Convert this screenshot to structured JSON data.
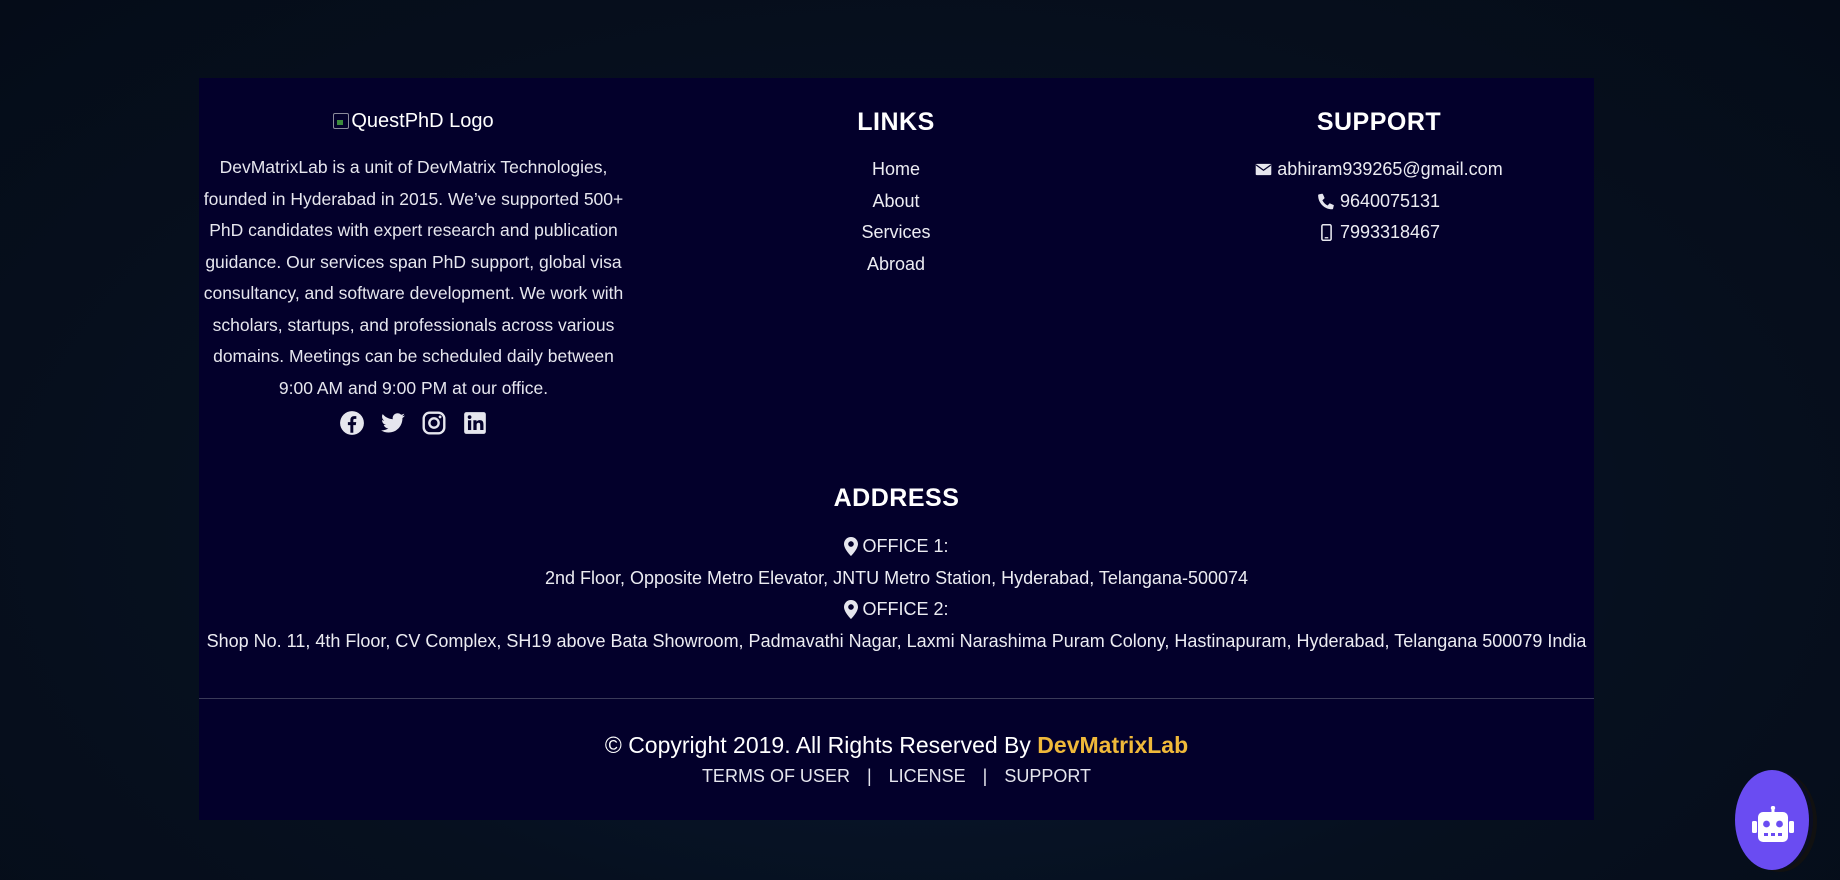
{
  "about": {
    "logo_alt": "QuestPhD Logo",
    "description": "DevMatrixLab is a unit of DevMatrix Technologies, founded in Hyderabad in 2015. We’ve supported 500+ PhD candidates with expert research and publication guidance. Our services span PhD support, global visa consultancy, and software development. We work with scholars, startups, and professionals across various domains. Meetings can be scheduled daily between 9:00 AM and 9:00 PM at our office.",
    "socials": [
      "facebook-icon",
      "twitter-icon",
      "instagram-icon",
      "linkedin-icon"
    ]
  },
  "links": {
    "heading": "LINKS",
    "items": [
      "Home",
      "About",
      "Services",
      "Abroad"
    ]
  },
  "support": {
    "heading": "SUPPORT",
    "email": "abhiram939265@gmail.com",
    "phone": "9640075131",
    "mobile": "7993318467"
  },
  "address": {
    "heading": "ADDRESS",
    "offices": [
      {
        "label": "OFFICE 1:",
        "text": "2nd Floor, Opposite Metro Elevator, JNTU Metro Station, Hyderabad, Telangana-500074"
      },
      {
        "label": "OFFICE 2:",
        "text": "Shop No. 11, 4th Floor, CV Complex, SH19 above Bata Showroom, Padmavathi Nagar, Laxmi Narashima Puram Colony, Hastinapuram, Hyderabad, Telangana 500079 India"
      }
    ]
  },
  "copyright": {
    "text": "© Copyright 2019. All Rights Reserved By ",
    "brand": "DevMatrixLab"
  },
  "bottom_links": {
    "terms": "TERMS OF USER",
    "license": "LICENSE",
    "support": "SUPPORT",
    "separator": "|"
  },
  "colors": {
    "footer_bg": "#03002b",
    "brand_accent": "#f0b93a",
    "chatbot": "#6a4cf2"
  },
  "chatbot": {
    "icon": "robot-icon"
  }
}
